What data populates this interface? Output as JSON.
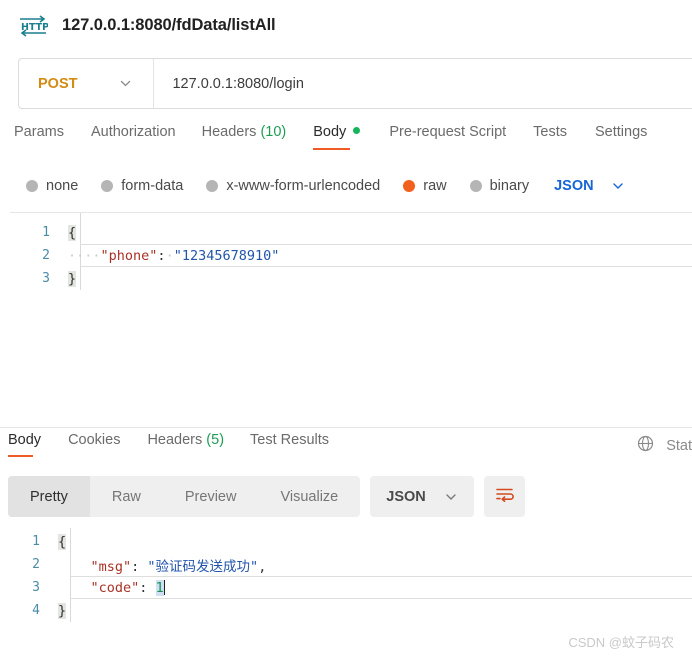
{
  "header": {
    "icon": "http-icon",
    "title": "127.0.0.1:8080/fdData/listAll"
  },
  "request_bar": {
    "method": "POST",
    "method_caret_icon": "chevron-down-icon",
    "url": "127.0.0.1:8080/login"
  },
  "request_tabs": [
    {
      "label": "Params",
      "active": false
    },
    {
      "label": "Authorization",
      "active": false
    },
    {
      "label": "Headers",
      "count": "(10)",
      "active": false
    },
    {
      "label": "Body",
      "active": true,
      "dot": true
    },
    {
      "label": "Pre-request Script",
      "active": false
    },
    {
      "label": "Tests",
      "active": false
    },
    {
      "label": "Settings",
      "active": false
    }
  ],
  "body_types": [
    {
      "label": "none",
      "selected": false
    },
    {
      "label": "form-data",
      "selected": false
    },
    {
      "label": "x-www-form-urlencoded",
      "selected": false
    },
    {
      "label": "raw",
      "selected": true
    },
    {
      "label": "binary",
      "selected": false
    }
  ],
  "body_format": {
    "label": "JSON",
    "caret_icon": "chevron-down-icon"
  },
  "request_body": {
    "lines": [
      "1",
      "2",
      "3"
    ],
    "line1": "{",
    "line2_ws": "····",
    "line2_key": "\"phone\"",
    "line2_colon": ":",
    "line2_sep": "·",
    "line2_val": "\"12345678910\"",
    "line3": "}"
  },
  "response_tabs": [
    {
      "label": "Body",
      "active": true
    },
    {
      "label": "Cookies",
      "active": false
    },
    {
      "label": "Headers",
      "count": "(5)",
      "active": false
    },
    {
      "label": "Test Results",
      "active": false
    }
  ],
  "response_status": {
    "globe_icon": "globe-icon",
    "label": "Stat"
  },
  "response_toolbar": {
    "views": [
      {
        "label": "Pretty",
        "active": true
      },
      {
        "label": "Raw",
        "active": false
      },
      {
        "label": "Preview",
        "active": false
      },
      {
        "label": "Visualize",
        "active": false
      }
    ],
    "format": "JSON",
    "format_caret_icon": "chevron-down-icon",
    "wrap_icon": "word-wrap-icon"
  },
  "response_body": {
    "lines": [
      "1",
      "2",
      "3",
      "4"
    ],
    "line1": "{",
    "line2_indent": "    ",
    "line2_key": "\"msg\"",
    "line2_colon": ": ",
    "line2_val": "\"验证码发送成功\"",
    "line2_comma": ",",
    "line3_indent": "    ",
    "line3_key": "\"code\"",
    "line3_colon": ": ",
    "line3_val": "1",
    "line4": "}"
  },
  "watermark": "CSDN @蚊子码农",
  "colors": {
    "accent_orange": "#ef5b25",
    "method_orange": "#d38b12",
    "raw_selected": "#f2601e",
    "json_blue": "#1565d8",
    "green_dot": "#16b45c",
    "header_count_green": "#1f9d55",
    "json_key_red": "#a93226",
    "json_string_blue": "#2255aa",
    "json_number_green": "#1a8f4e",
    "gutter_teal": "#4a8ba8"
  }
}
